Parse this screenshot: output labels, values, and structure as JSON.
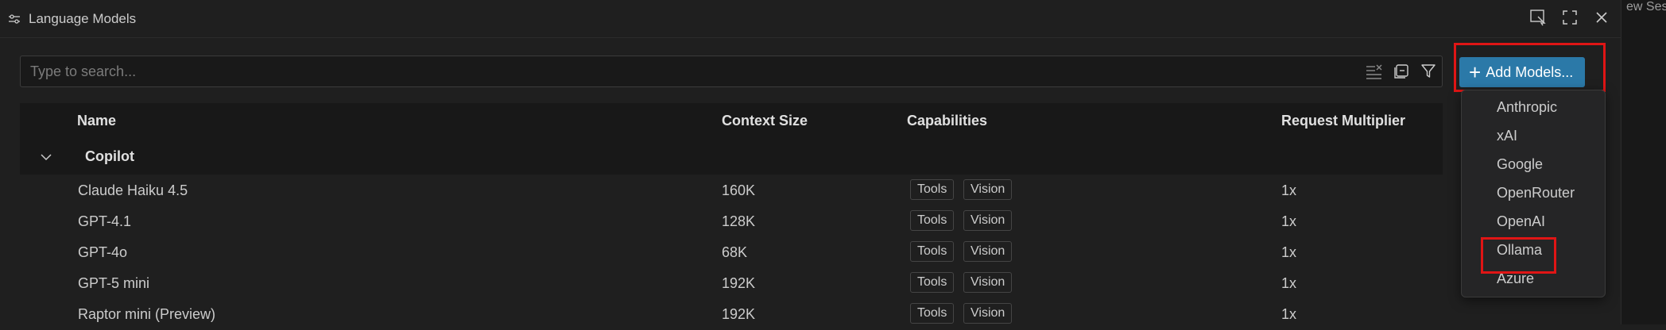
{
  "backdrop": {
    "text": "ew Sessi"
  },
  "titlebar": {
    "title": "Language Models"
  },
  "search": {
    "placeholder": "Type to search..."
  },
  "add_button": {
    "label": "Add Models..."
  },
  "table": {
    "headers": {
      "name": "Name",
      "context": "Context Size",
      "capabilities": "Capabilities",
      "multiplier": "Request Multiplier"
    },
    "group": "Copilot",
    "rows": [
      {
        "name": "Claude Haiku 4.5",
        "context": "160K",
        "caps": [
          "Tools",
          "Vision"
        ],
        "multiplier": "1x"
      },
      {
        "name": "GPT-4.1",
        "context": "128K",
        "caps": [
          "Tools",
          "Vision"
        ],
        "multiplier": "1x"
      },
      {
        "name": "GPT-4o",
        "context": "68K",
        "caps": [
          "Tools",
          "Vision"
        ],
        "multiplier": "1x"
      },
      {
        "name": "GPT-5 mini",
        "context": "192K",
        "caps": [
          "Tools",
          "Vision"
        ],
        "multiplier": "1x"
      },
      {
        "name": "Raptor mini (Preview)",
        "context": "192K",
        "caps": [
          "Tools",
          "Vision"
        ],
        "multiplier": "1x"
      }
    ]
  },
  "menu": {
    "items": [
      "Anthropic",
      "xAI",
      "Google",
      "OpenRouter",
      "OpenAI",
      "Ollama",
      "Azure"
    ]
  },
  "colors": {
    "accent": "#2b79a8",
    "highlight": "#e01515",
    "background": "#1f1f1f"
  }
}
